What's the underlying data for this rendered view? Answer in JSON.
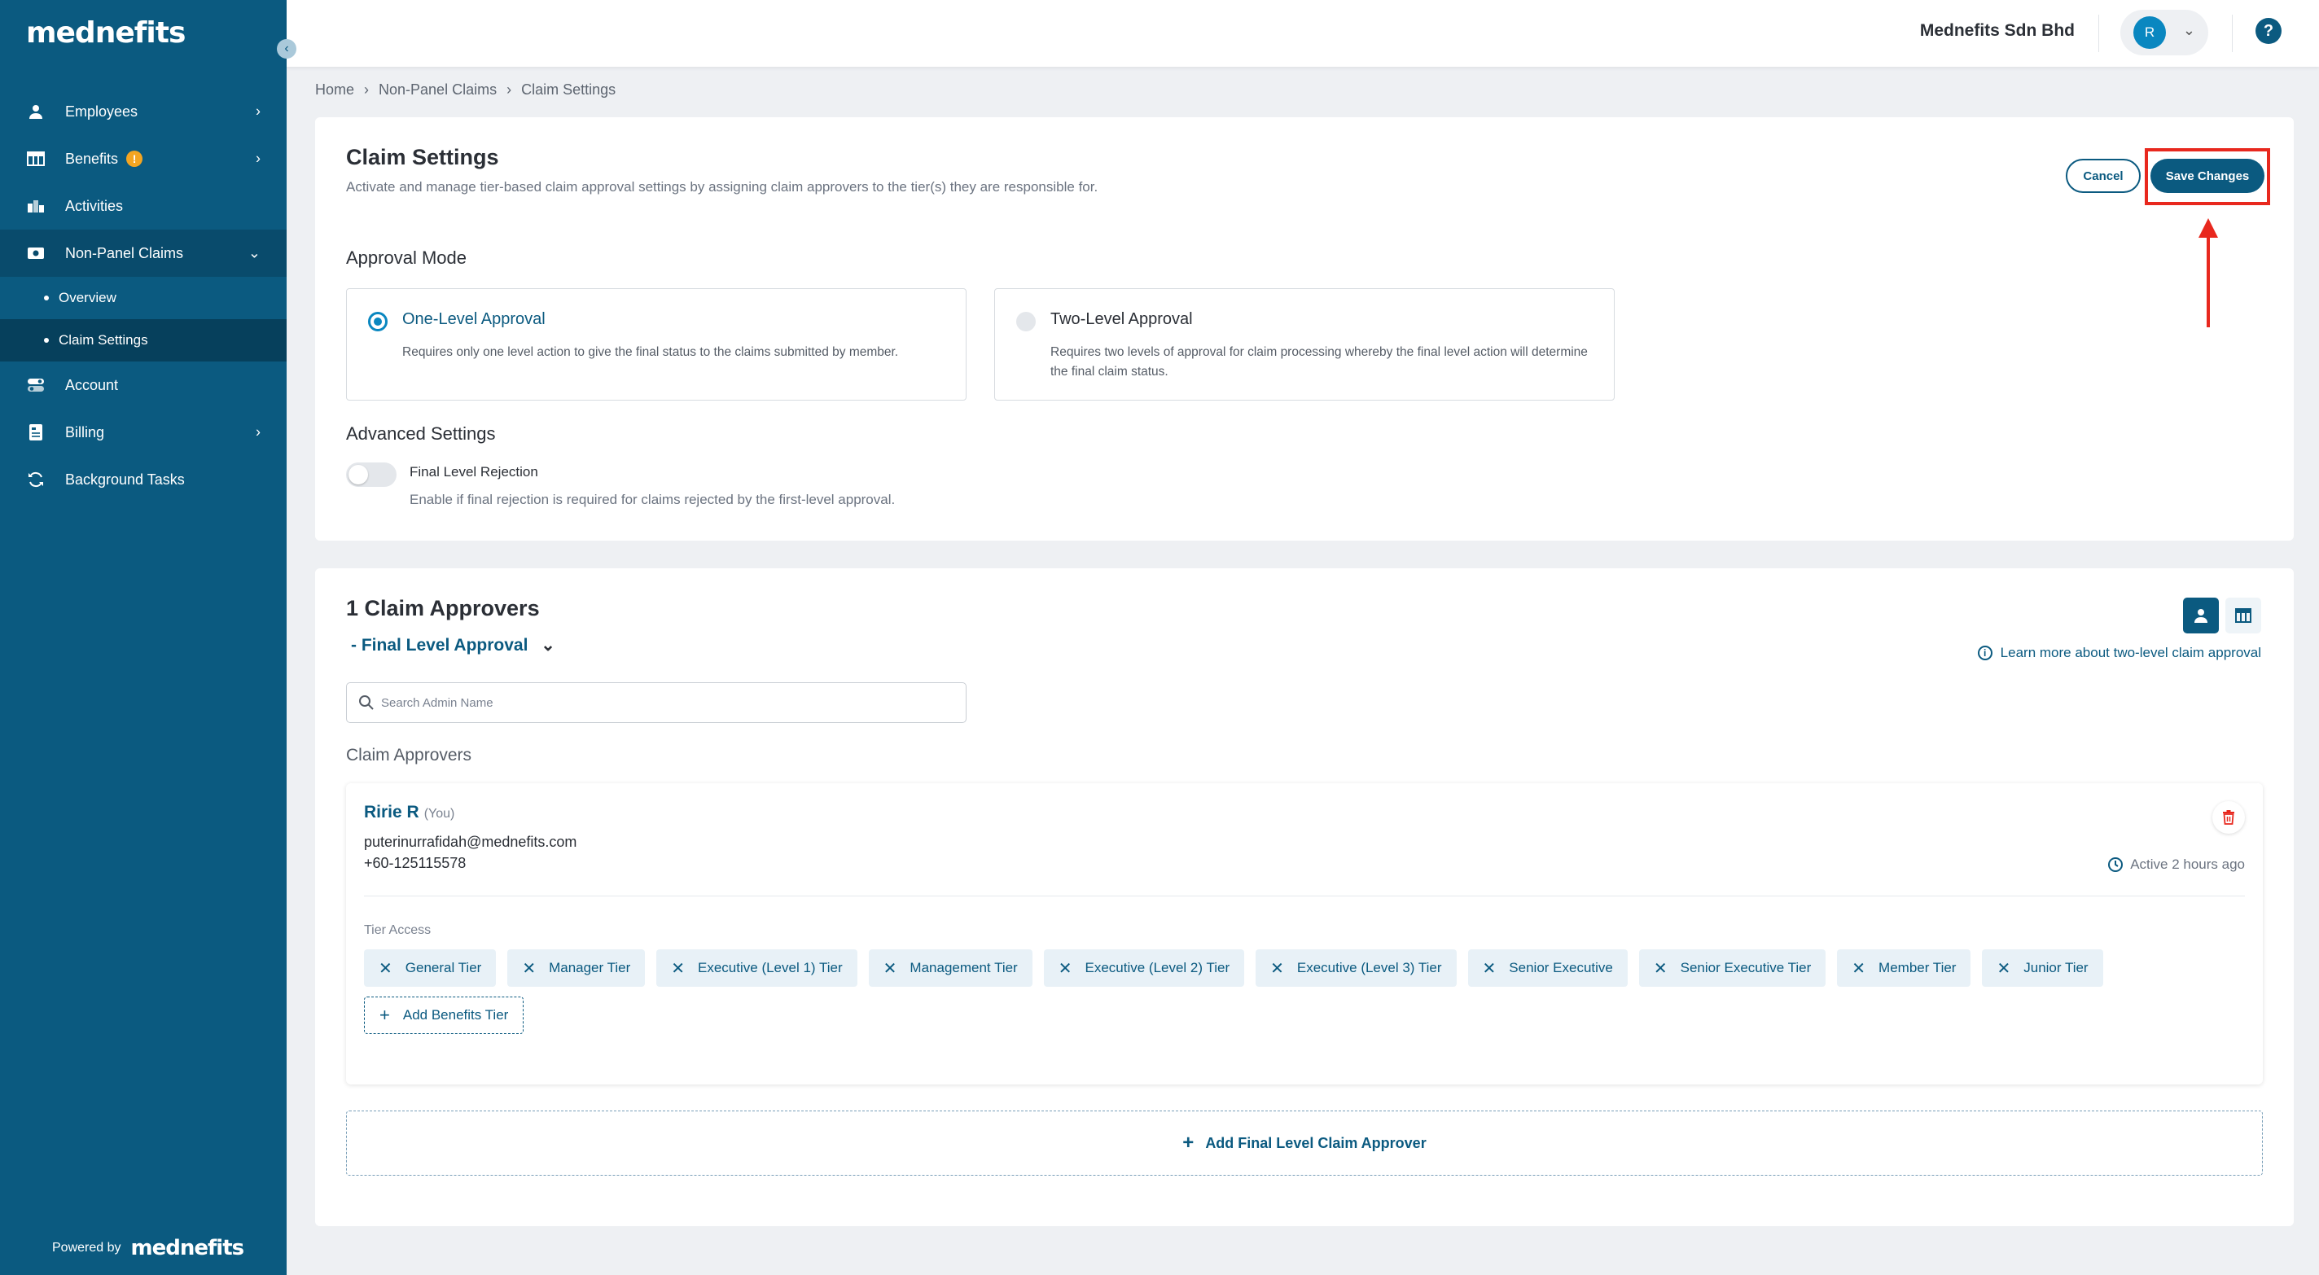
{
  "brand": {
    "logo": "mednefits",
    "powered_by": "Powered by",
    "powered_logo": "mednefits"
  },
  "sidebar": {
    "items": [
      {
        "label": "Employees",
        "icon": "user-icon"
      },
      {
        "label": "Benefits",
        "icon": "table-icon",
        "badge": "!"
      },
      {
        "label": "Activities",
        "icon": "chart-icon"
      },
      {
        "label": "Non-Panel Claims",
        "icon": "cash-icon"
      },
      {
        "label": "Account",
        "icon": "toggle-icon"
      },
      {
        "label": "Billing",
        "icon": "invoice-icon"
      },
      {
        "label": "Background Tasks",
        "icon": "refresh-icon"
      }
    ],
    "sub_items": [
      {
        "label": "Overview"
      },
      {
        "label": "Claim Settings"
      }
    ]
  },
  "topbar": {
    "company": "Mednefits Sdn Bhd",
    "avatar_initial": "R",
    "help": "?"
  },
  "breadcrumb": {
    "home": "Home",
    "section": "Non-Panel Claims",
    "current": "Claim Settings",
    "sep": "›"
  },
  "settings": {
    "title": "Claim Settings",
    "subtitle": "Activate and manage tier-based claim approval settings by assigning claim approvers to the tier(s) they are responsible for.",
    "cancel": "Cancel",
    "save": "Save Changes",
    "approval_mode_label": "Approval Mode",
    "modes": [
      {
        "title": "One-Level Approval",
        "desc": "Requires only one level action to give the final status to the claims submitted by member.",
        "selected": true
      },
      {
        "title": "Two-Level Approval",
        "desc": "Requires two levels of approval for claim processing whereby the final level action will determine the final claim status.",
        "selected": false
      }
    ],
    "advanced_label": "Advanced Settings",
    "toggle_title": "Final Level Rejection",
    "toggle_desc": "Enable if final rejection is required for claims rejected by the first-level approval.",
    "toggle_on": false
  },
  "approvers": {
    "title": "1 Claim Approvers",
    "level": "- Final Level Approval",
    "learn_more": "Learn more about two-level claim approval",
    "search_placeholder": "Search Admin Name",
    "list_label": "Claim Approvers",
    "approver": {
      "name": "Ririe R",
      "you": "(You)",
      "email": "puterinurrafidah@mednefits.com",
      "phone": "+60-125115578",
      "active": "Active 2 hours ago",
      "tier_access_label": "Tier Access",
      "tiers": [
        "General Tier",
        "Manager Tier",
        "Executive (Level 1) Tier",
        "Management Tier",
        "Executive (Level 2) Tier",
        "Executive (Level 3) Tier",
        "Senior Executive",
        "Senior Executive Tier",
        "Member Tier",
        "Junior Tier"
      ],
      "add_tier": "Add Benefits Tier"
    },
    "add_final": "Add Final Level Claim Approver"
  },
  "colors": {
    "primary": "#0b5a80",
    "accent": "#0a87c0",
    "highlight": "#e8281e",
    "warning": "#f4a521"
  }
}
